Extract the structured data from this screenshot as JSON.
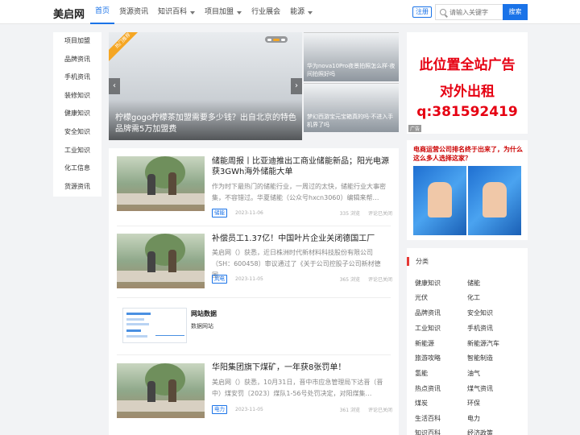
{
  "header": {
    "logo": "美启网",
    "nav": [
      {
        "label": "首页",
        "active": true,
        "dropdown": false
      },
      {
        "label": "货源资讯",
        "active": false,
        "dropdown": false
      },
      {
        "label": "知识百科",
        "active": false,
        "dropdown": true
      },
      {
        "label": "项目加盟",
        "active": false,
        "dropdown": true
      },
      {
        "label": "行业展会",
        "active": false,
        "dropdown": false
      },
      {
        "label": "能源",
        "active": false,
        "dropdown": true
      }
    ],
    "register": "注册",
    "search_placeholder": "请输入关键字",
    "search_button": "搜索"
  },
  "sidebar": {
    "items": [
      "项目加盟",
      "品牌资讯",
      "手机资讯",
      "装修知识",
      "健康知识",
      "安全知识",
      "工业知识",
      "化工信息",
      "货源资讯"
    ]
  },
  "carousel": {
    "title": "柠檬gogo柠檬茶加盟需要多少钱？出自北京的特色品牌需5万加盟费",
    "ribbon": "热门推荐",
    "prev": "‹",
    "next": "›",
    "thumbs": [
      {
        "caption": "华为nova10Pro夜景拍照怎么样·夜间拍照好吗"
      },
      {
        "caption": "梦幻西游宝元宝箱真的吗·不进入手机界了吗"
      }
    ]
  },
  "articles": [
    {
      "title": "储能周报丨比亚迪推出工商业储能新品；阳光电源获3GWh海外储能大单",
      "desc": "作为时下最热门的储能行业，一周过的太快，储能行业大事密集，不容错过。华夏储能（公众号hxcn3060）编辑来帮…",
      "tag": "储能",
      "date": "2023-11-06",
      "views": "335 浏览",
      "comments": "评论已关闭"
    },
    {
      "title": "补偿员工1.37亿！中国叶片企业关闭德国工厂",
      "desc": "美启网（）获悉，近日株洲时代新材料科技股份有限公司（SH：600458）审议通过了《关于公司控股子公司新材德国…",
      "tag": "风电",
      "date": "2023-11-05",
      "views": "365 浏览",
      "comments": "评论已关闭"
    },
    {
      "title": "华阳集团旗下煤矿，一年获8张罚单！",
      "desc": "美启网（）获悉，10月31日，晋中市应急管理局下达晋（晋中）煤安罚〔2023〕煤队1-56号处罚决定，对阳煤集…",
      "tag": "电力",
      "date": "2023-11-05",
      "views": "361 浏览",
      "comments": "评论已关闭"
    }
  ],
  "promo": {
    "title": "网站数据",
    "subtitle": "数据网站"
  },
  "ad": {
    "lines": [
      "此位置全站广告",
      "对外出租",
      "q:381592419"
    ],
    "tag": "广告"
  },
  "ad2": {
    "title": "电商运营公司排名终于出来了，为什么这么多人选择这家？"
  },
  "categories": {
    "title": "分类",
    "items": [
      "健康知识",
      "储能",
      "光伏",
      "化工",
      "品牌资讯",
      "安全知识",
      "工业知识",
      "手机资讯",
      "新能源",
      "新能源汽车",
      "旅游攻略",
      "智能制造",
      "氢能",
      "油气",
      "热点资讯",
      "煤气资讯",
      "煤炭",
      "环保",
      "生活百科",
      "电力",
      "知识百科",
      "经济政策"
    ]
  },
  "colors": {
    "accent": "#1a73e8",
    "ad_red": "#e60012",
    "category_mark": "#e53935"
  }
}
